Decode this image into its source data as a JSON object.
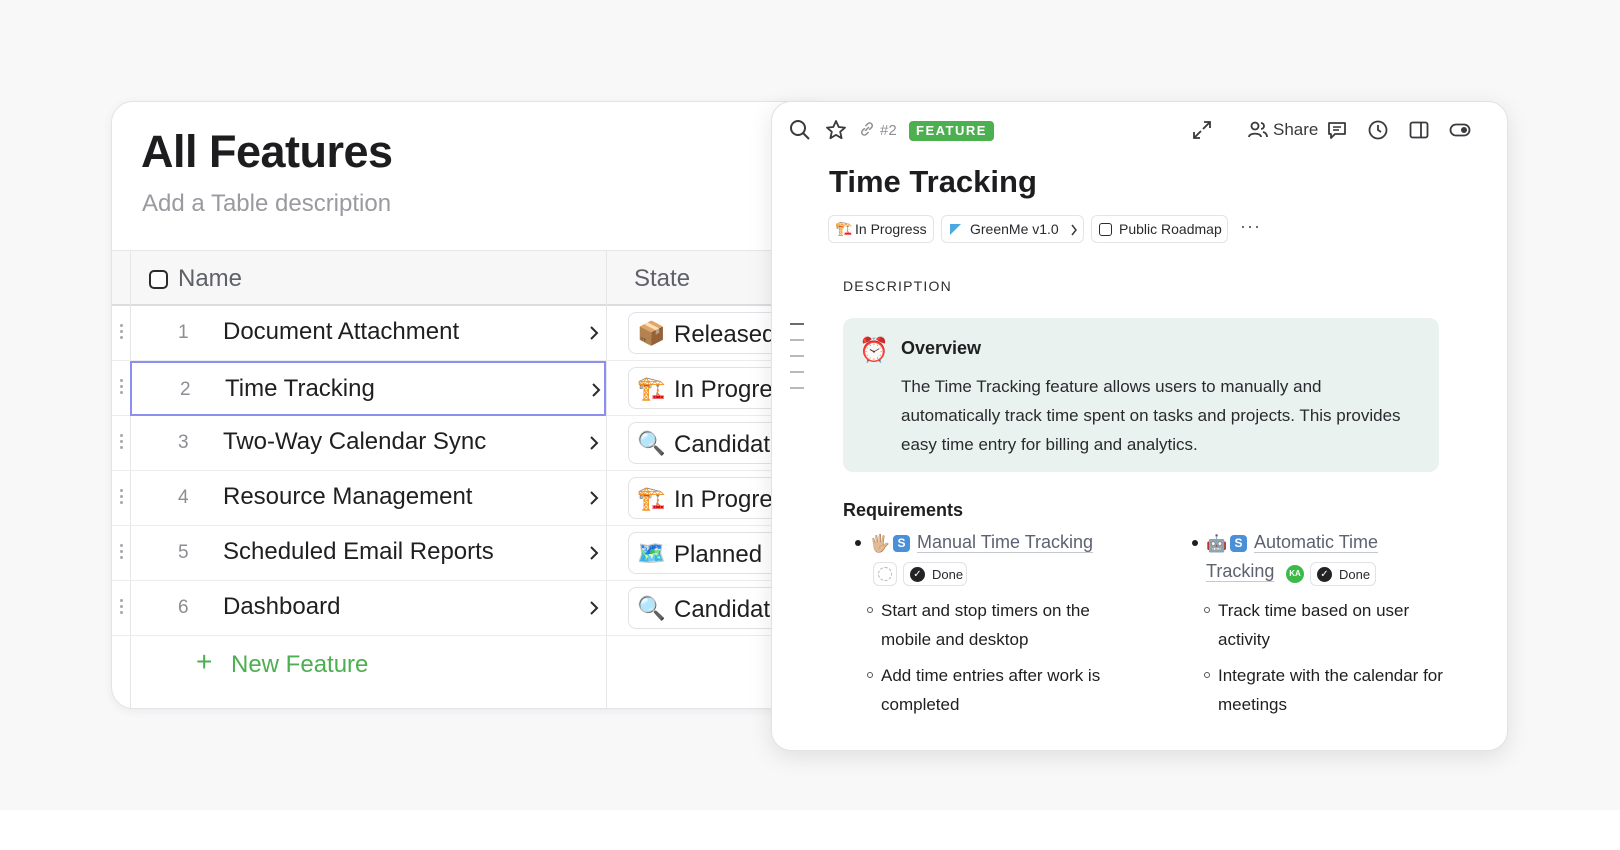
{
  "table": {
    "title": "All Features",
    "description_placeholder": "Add a Table description",
    "columns": {
      "name": "Name",
      "state": "State"
    },
    "rows": [
      {
        "num": "1",
        "name": "Document Attachment",
        "state": "Released",
        "state_icon": "📦"
      },
      {
        "num": "2",
        "name": "Time Tracking",
        "state": "In Progress",
        "state_icon": "🏗️"
      },
      {
        "num": "3",
        "name": "Two-Way Calendar Sync",
        "state": "Candidate",
        "state_icon": "🔍"
      },
      {
        "num": "4",
        "name": "Resource Management",
        "state": "In Progress",
        "state_icon": "🏗️"
      },
      {
        "num": "5",
        "name": "Scheduled Email Reports",
        "state": "Planned",
        "state_icon": "🗺️"
      },
      {
        "num": "6",
        "name": "Dashboard",
        "state": "Candidate",
        "state_icon": "🔍"
      }
    ],
    "new_label": "New Feature",
    "accent": "#4caf50"
  },
  "panel": {
    "issue_number": "#2",
    "badge": "FEATURE",
    "share_label": "Share",
    "title": "Time Tracking",
    "properties": {
      "state": "In Progress",
      "release": "GreenMe v1.0",
      "roadmap": "Public Roadmap"
    },
    "section_label": "DESCRIPTION",
    "overview": {
      "heading": "Overview",
      "text": "The Time Tracking feature allows users to manually and automatically track time spent on tasks and projects. This provides easy time entry for billing and analytics."
    },
    "requirements": {
      "heading": "Requirements",
      "items": [
        {
          "badge": "S",
          "title": "Manual Time Tracking",
          "status": "Done",
          "subitems": [
            "Start and stop timers on the mobile and desktop",
            "Add time entries after work is completed"
          ]
        },
        {
          "badge": "S",
          "title": "Automatic Time Tracking",
          "title_line1": "Automatic Time",
          "title_line2": "Tracking",
          "avatar": "KA",
          "status": "Done",
          "subitems": [
            "Track time based on user activity",
            "Integrate with the calendar for meetings"
          ]
        }
      ]
    }
  }
}
